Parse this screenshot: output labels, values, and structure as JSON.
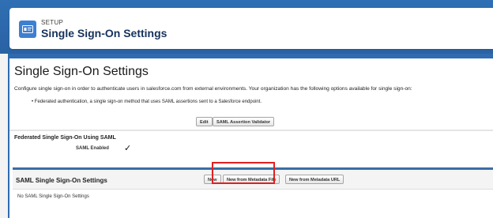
{
  "header": {
    "setup_label": "SETUP",
    "title": "Single Sign-On Settings"
  },
  "page": {
    "title": "Single Sign-On Settings",
    "description": "Configure single sign-on in order to authenticate users in salesforce.com from external environments. Your organization has the following options available for single sign-on:",
    "bullet": "Federated authentication, a single sign-on method that uses SAML assertions sent to a Salesforce endpoint."
  },
  "toolbar": {
    "edit_label": "Edit",
    "validator_label": "SAML Assertion Validator"
  },
  "federated": {
    "title": "Federated Single Sign-On Using SAML",
    "saml_enabled_label": "SAML Enabled",
    "saml_enabled_value": "✓"
  },
  "saml_settings": {
    "title": "SAML Single Sign-On Settings",
    "new_label": "New",
    "new_metadata_file_label": "New from Metadata File",
    "new_metadata_url_label": "New from Metadata URL",
    "empty_message": "No SAML Single Sign-On Settings"
  },
  "colors": {
    "brand": "#2e6bb0",
    "icon_bg": "#3d7fd1",
    "highlight": "#e02020",
    "section_border": "#3a6ea5"
  },
  "icons": {
    "header": "id-card-icon"
  }
}
